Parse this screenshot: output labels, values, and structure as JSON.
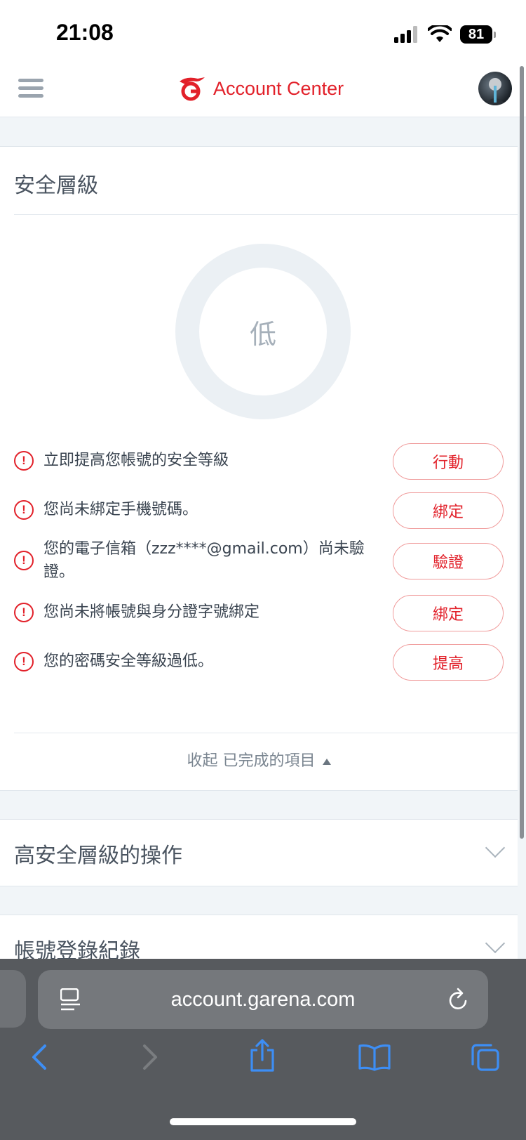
{
  "status_bar": {
    "time": "21:08",
    "battery": "81"
  },
  "header": {
    "title": "Account Center"
  },
  "security": {
    "title": "安全層級",
    "level": "低",
    "tasks": [
      {
        "text": "立即提高您帳號的安全等級",
        "action": "行動"
      },
      {
        "text": "您尚未綁定手機號碼。",
        "action": "綁定"
      },
      {
        "text": "您的電子信箱（zzz****@gmail.com）尚未驗證。",
        "action": "驗證"
      },
      {
        "text": "您尚未將帳號與身分證字號綁定",
        "action": "綁定"
      },
      {
        "text": "您的密碼安全等級過低。",
        "action": "提高"
      }
    ],
    "collapse_label": "收起 已完成的項目"
  },
  "sections": [
    {
      "title": "高安全層級的操作"
    },
    {
      "title": "帳號登錄紀錄"
    }
  ],
  "browser": {
    "url": "account.garena.com"
  },
  "colors": {
    "accent": "#e2212a",
    "browser_bg": "#575a5e",
    "toolbar_icon": "#3d8ef5"
  }
}
